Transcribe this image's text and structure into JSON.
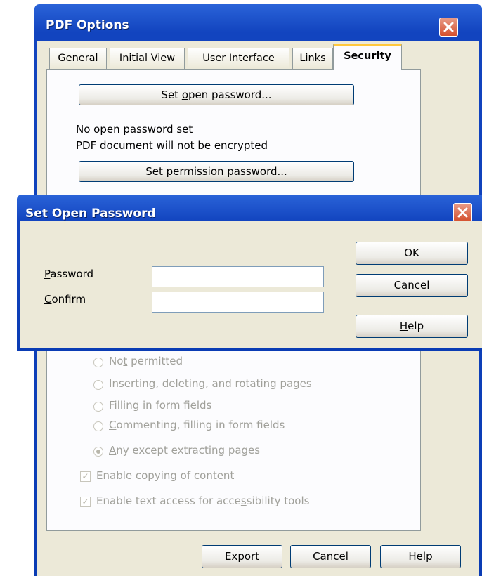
{
  "pdf_options": {
    "title": "PDF Options",
    "tabs": [
      {
        "label": "General"
      },
      {
        "label": "Initial View"
      },
      {
        "label": "User Interface"
      },
      {
        "label": "Links"
      },
      {
        "label": "Security"
      }
    ],
    "active_tab": "Security",
    "security": {
      "set_open_password_button": {
        "pre": "Set ",
        "key": "o",
        "post": "pen password..."
      },
      "open_password_status": "No open password set",
      "encryption_status": "PDF document will not be encrypted",
      "set_permission_password_button": {
        "pre": "Set ",
        "key": "p",
        "post": "ermission password..."
      },
      "changes_options": [
        {
          "pre": "No",
          "key": "t",
          "post": " permitted",
          "selected": false
        },
        {
          "pre": "",
          "key": "I",
          "post": "nserting, deleting, and rotating pages",
          "selected": false
        },
        {
          "pre": "",
          "key": "F",
          "post": "illing in form fields",
          "selected": false
        },
        {
          "pre": "",
          "key": "C",
          "post": "ommenting, filling in form fields",
          "selected": false
        },
        {
          "pre": "",
          "key": "A",
          "post": "ny except extracting pages",
          "selected": true
        }
      ],
      "copy_checkbox": {
        "pre": "Ena",
        "key": "b",
        "post": "le copying of content",
        "checked": true
      },
      "accessibility_checkbox": {
        "pre": "Enable text access for acce",
        "key": "s",
        "post": "sibility tools",
        "checked": true
      }
    },
    "footer": {
      "export": {
        "pre": "E",
        "key": "x",
        "post": "port"
      },
      "cancel": "Cancel",
      "help": {
        "pre": "",
        "key": "H",
        "post": "elp"
      }
    }
  },
  "set_open_password": {
    "title": "Set Open Password",
    "password_label": {
      "pre": "",
      "key": "P",
      "post": "assword"
    },
    "confirm_label": {
      "pre": "",
      "key": "C",
      "post": "onfirm"
    },
    "password_value": "",
    "confirm_value": "",
    "ok": "OK",
    "cancel": "Cancel",
    "help": {
      "pre": "",
      "key": "H",
      "post": "elp"
    }
  },
  "colors": {
    "title_bar": "#0a3cb4",
    "dialog_face": "#ece9d8",
    "active_tab_accent": "#ffc83c",
    "close_button": "#d4502e"
  },
  "icons": {
    "close": "close-icon"
  }
}
